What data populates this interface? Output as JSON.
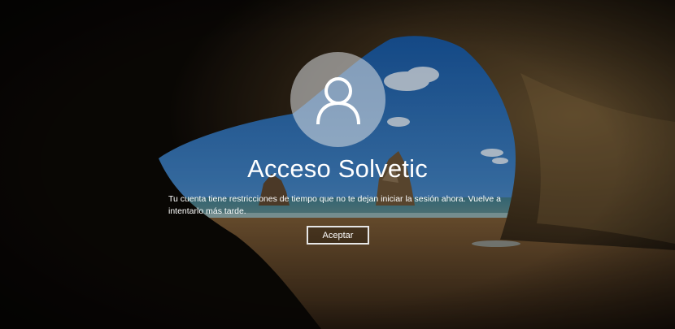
{
  "lock_screen": {
    "user_name": "Acceso Solvetic",
    "message": "Tu cuenta tiene restricciones de tiempo que no te dejan iniciar la sesión ahora. Vuelve a intentarlo más tarde.",
    "button_label": "Aceptar",
    "avatar_icon": "user-icon"
  },
  "colors": {
    "text": "#ffffff",
    "avatar_bg": "#dcdfe3",
    "button_border": "#e6e6e6"
  }
}
